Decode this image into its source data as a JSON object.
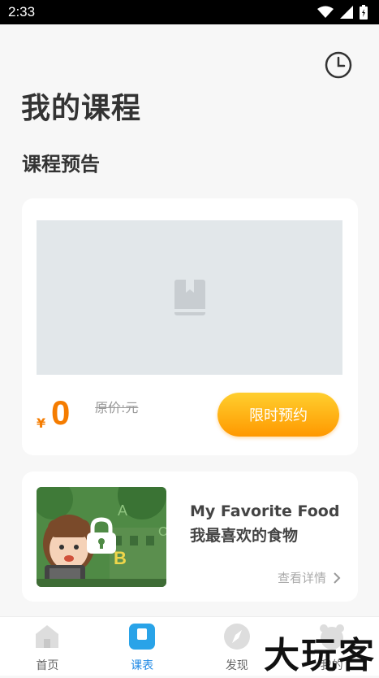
{
  "status_bar": {
    "time": "2:33"
  },
  "page": {
    "title": "我的课程",
    "section_title": "课程预告"
  },
  "preview_card": {
    "currency": "¥",
    "price": "0",
    "original_price": "原价:元",
    "reserve_button": "限时预约"
  },
  "course_card": {
    "title": "My Favorite Food 我最喜欢的食物",
    "detail_link": "查看详情"
  },
  "tabbar": {
    "items": [
      {
        "label": "首页",
        "icon": "home-icon"
      },
      {
        "label": "课表",
        "icon": "schedule-icon"
      },
      {
        "label": "发现",
        "icon": "compass-icon"
      },
      {
        "label": "我的",
        "icon": "bear-icon"
      }
    ],
    "active_index": 1
  },
  "watermark": "大玩客",
  "colors": {
    "accent_orange": "#f57c00",
    "button_gradient_top": "#ffcf2e",
    "button_gradient_bottom": "#ff9800",
    "active_tab": "#1e88e5",
    "placeholder_bg": "#e2e7ea"
  }
}
